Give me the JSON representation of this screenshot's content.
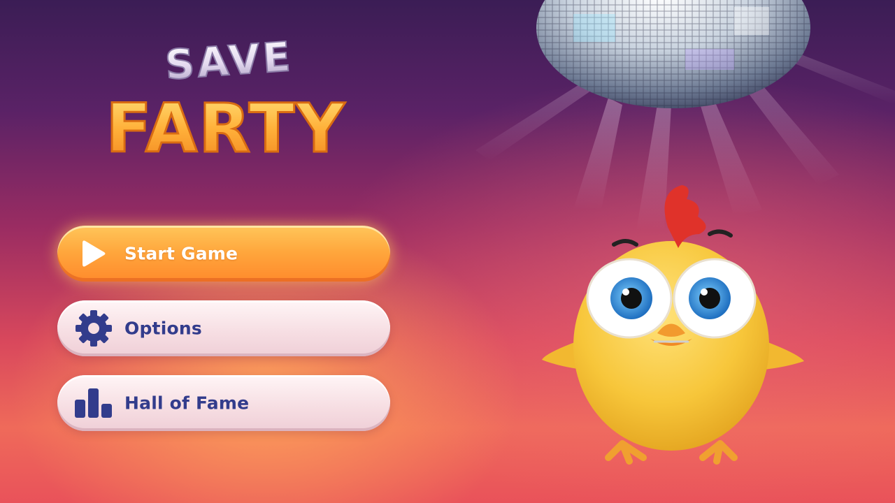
{
  "title": {
    "line1": "SAVE",
    "line2": "FARTY"
  },
  "menu": {
    "start_label": "Start Game",
    "options_label": "Options",
    "hall_label": "Hall of Fame"
  },
  "icons": {
    "start": "play-icon",
    "options": "gear-icon",
    "hall": "bar-chart-icon"
  },
  "colors": {
    "start_button": "#ffa63c",
    "menu_button": "#f6dde2",
    "menu_text": "#323c8c",
    "title_top": "#e6dcf2",
    "title_bottom": "#ffaa32",
    "chick_body": "#f7c63a",
    "chick_comb": "#e0322a"
  }
}
